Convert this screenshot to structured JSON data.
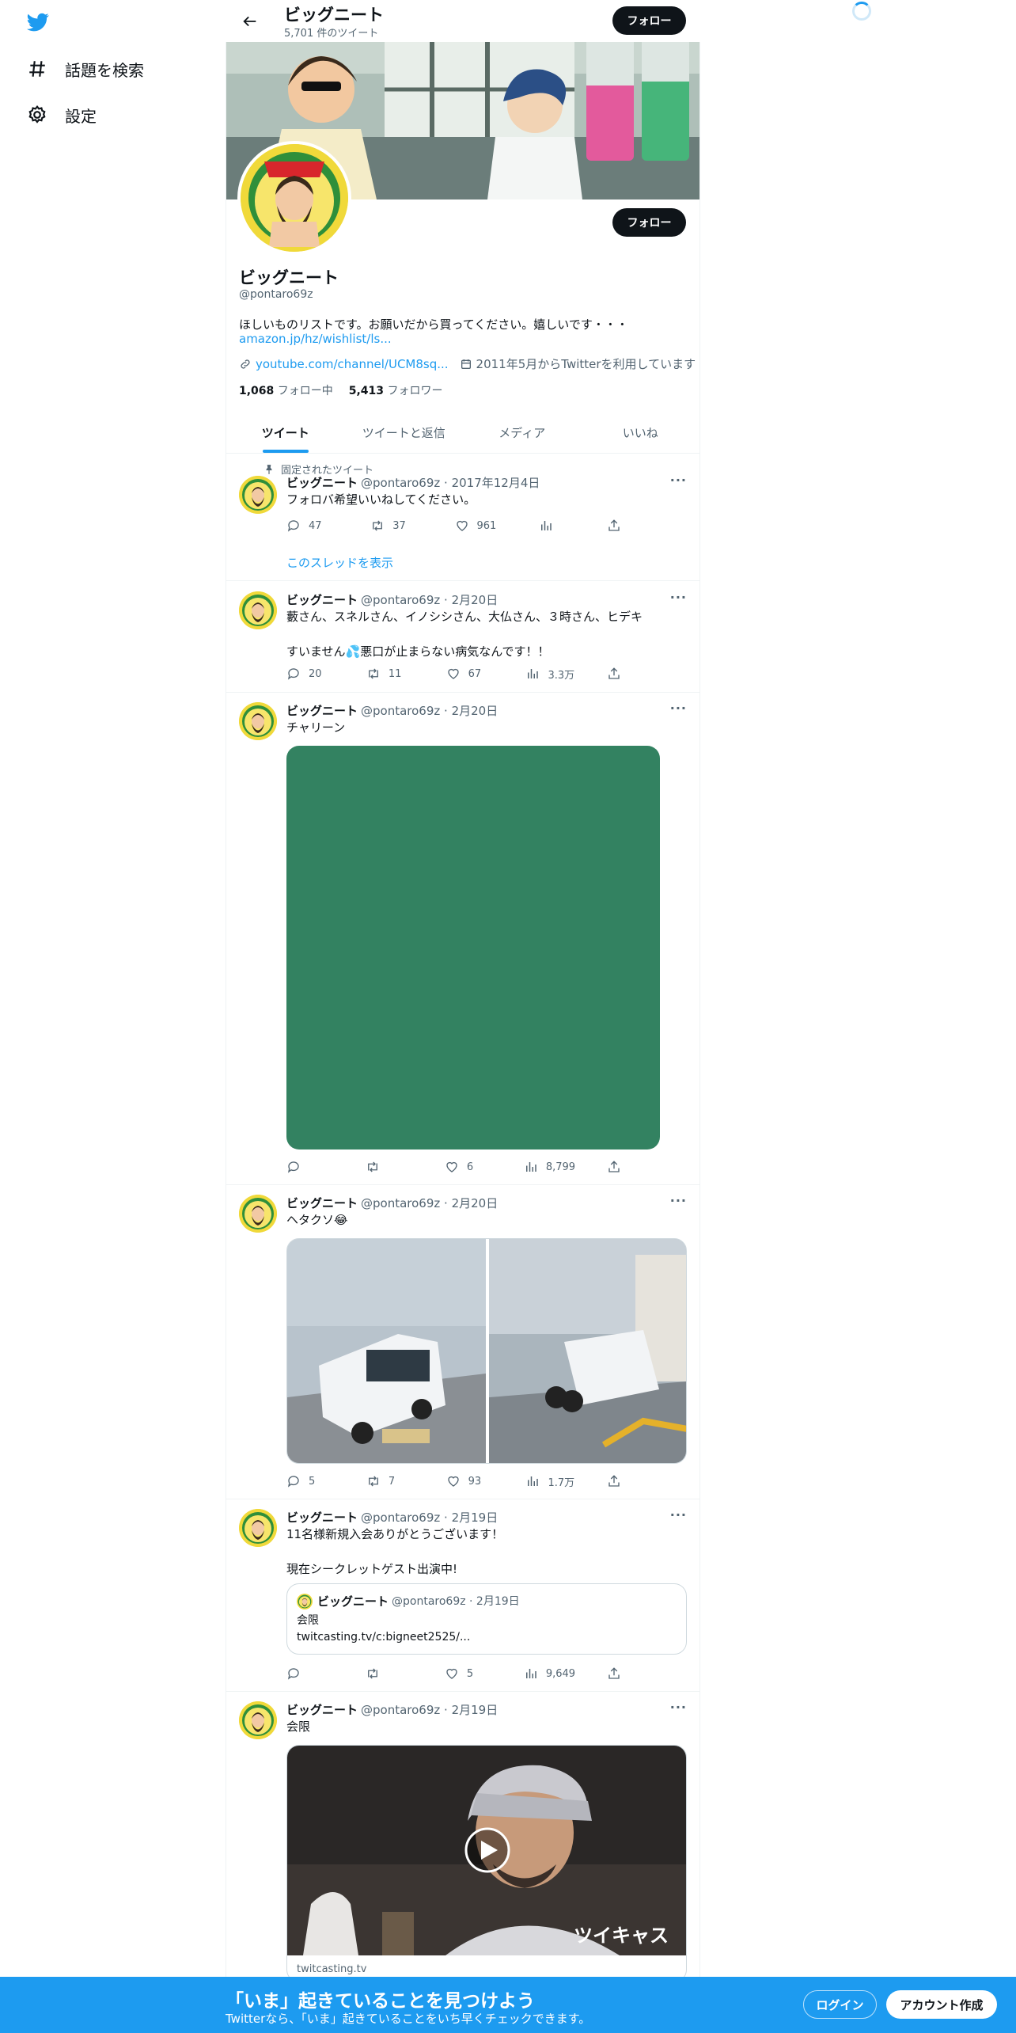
{
  "nav": {
    "logo_icon": "twitter-bird-icon",
    "items": [
      {
        "label": "話題を検索",
        "icon": "hashtag-icon"
      },
      {
        "label": "設定",
        "icon": "gear-icon"
      }
    ]
  },
  "header": {
    "title": "ビッグニート",
    "subtitle": "5,701 件のツイート",
    "follow_label": "フォロー"
  },
  "profile": {
    "name": "ビッグニート",
    "handle": "@pontaro69z",
    "bio": "ほしいものリストです。お願いだから買ってください。嬉しいです・・・",
    "bio_link": "amazon.jp/hz/wishlist/ls...",
    "website": "youtube.com/channel/UCM8sq...",
    "joined": "2011年5月からTwitterを利用しています",
    "following_count": "1,068",
    "following_label": "フォロー中",
    "followers_count": "5,413",
    "followers_label": "フォロワー",
    "follow_label": "フォロー"
  },
  "tabs": [
    "ツイート",
    "ツイートと返信",
    "メディア",
    "いいね"
  ],
  "tweets": [
    {
      "pinned_label": "固定されたツイート",
      "name": "ビッグニート",
      "meta": "@pontaro69z · 2017年12月4日",
      "text": "フォロバ希望いいねしてください。",
      "replies": "47",
      "retweets": "37",
      "likes": "961",
      "views": "",
      "thread_link": "このスレッドを表示"
    },
    {
      "name": "ビッグニート",
      "meta": "@pontaro69z · 2月20日",
      "text": "藪さん、スネルさん、イノシシさん、大仏さん、３時さん、ヒデキ\n\nすいません💦悪口が止まらない病気なんです！！",
      "replies": "20",
      "retweets": "11",
      "likes": "67",
      "views": "3.3万"
    },
    {
      "name": "ビッグニート",
      "meta": "@pontaro69z · 2月20日",
      "text": "チャリーン",
      "replies": "",
      "retweets": "",
      "likes": "6",
      "views": "8,799",
      "media_color": "#338261"
    },
    {
      "name": "ビッグニート",
      "meta": "@pontaro69z · 2月20日",
      "text": "ヘタクソ😂",
      "replies": "5",
      "retweets": "7",
      "likes": "93",
      "views": "1.7万"
    },
    {
      "name": "ビッグニート",
      "meta": "@pontaro69z · 2月19日",
      "text": "11名様新規入会ありがとうございます！\n\n現在シークレットゲスト出演中!",
      "quote": {
        "name": "ビッグニート",
        "meta": "@pontaro69z · 2月19日",
        "text": "会限\ntwitcasting.tv/c:bigneet2525/..."
      },
      "replies": "",
      "retweets": "",
      "likes": "5",
      "views": "9,649"
    },
    {
      "name": "ビッグニート",
      "meta": "@pontaro69z · 2月19日",
      "text": "会限",
      "card_brand": "ツイキャス",
      "card_domain": "twitcasting.tv"
    }
  ],
  "bottom_bar": {
    "title": "「いま」起きていることを見つけよう",
    "subtitle": "Twitterなら、「いま」起きていることをいち早くチェックできます。",
    "login_label": "ログイン",
    "signup_label": "アカウント作成"
  },
  "colors": {
    "accent": "#1d9bf0",
    "text": "#0f1419",
    "secondary": "#536471",
    "media_green": "#338261"
  }
}
